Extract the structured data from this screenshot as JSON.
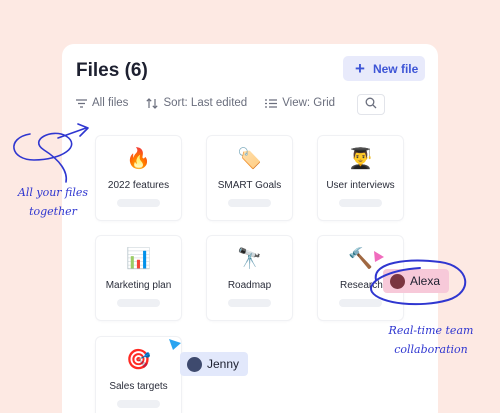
{
  "header": {
    "title": "Files (6)",
    "new_file_label": "New file"
  },
  "toolbar": {
    "filter_label": "All files",
    "sort_label": "Sort: Last edited",
    "view_label": "View: Grid"
  },
  "files": [
    {
      "name": "2022 features",
      "icon": "fire-icon",
      "emoji": "🔥"
    },
    {
      "name": "SMART Goals",
      "icon": "tag-icon",
      "emoji": "🏷️"
    },
    {
      "name": "User interviews",
      "icon": "graduate-icon",
      "emoji": "👨‍🎓"
    },
    {
      "name": "Marketing plan",
      "icon": "bar-chart-icon",
      "emoji": "📊"
    },
    {
      "name": "Roadmap",
      "icon": "telescope-icon",
      "emoji": "🔭"
    },
    {
      "name": "Research",
      "icon": "hammer-icon",
      "emoji": "🔨"
    },
    {
      "name": "Sales targets",
      "icon": "target-icon",
      "emoji": "🎯"
    }
  ],
  "annotations": {
    "files_note_line1": "All your files",
    "files_note_line2": "together",
    "collab_note_line1": "Real-time team",
    "collab_note_line2": "collaboration"
  },
  "collaborators": [
    {
      "name": "Alexa",
      "color": "#f7c9d9",
      "cursor_color": "#f06bbd"
    },
    {
      "name": "Jenny",
      "color": "#e2e8fb",
      "cursor_color": "#2aa4f0"
    }
  ],
  "colors": {
    "background": "#fde9e3",
    "accent": "#3e55d6",
    "annotation_ink": "#2f36d0"
  }
}
